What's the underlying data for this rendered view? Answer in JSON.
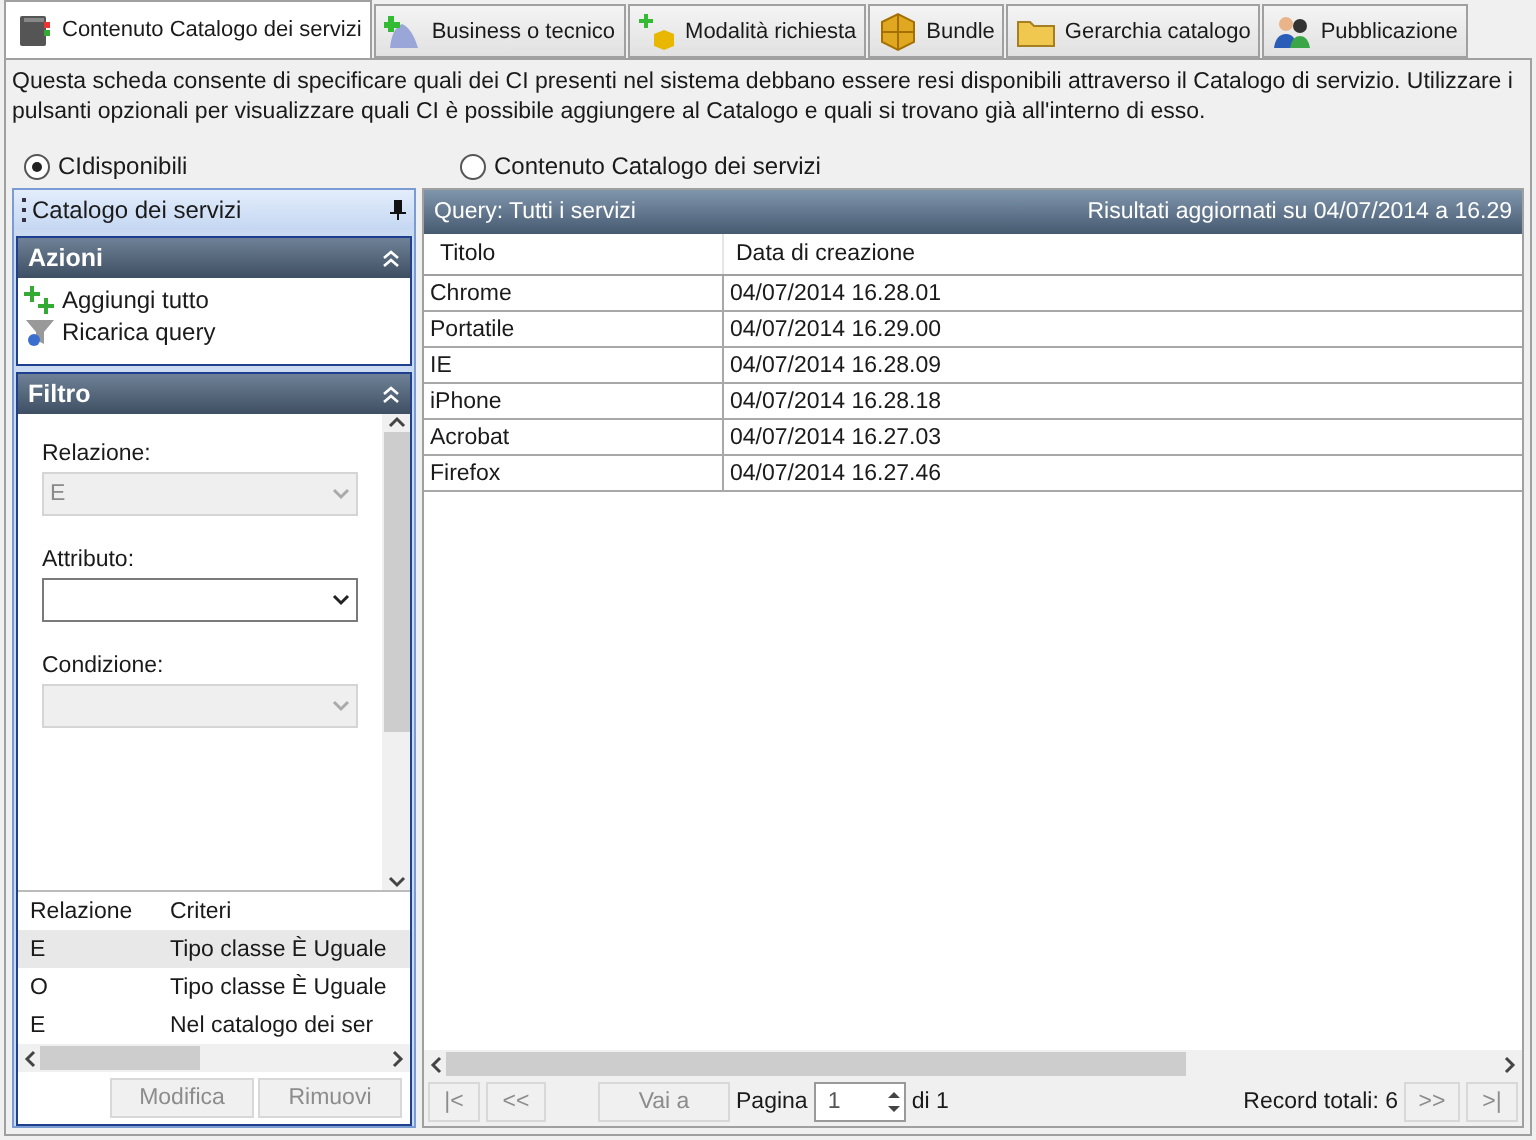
{
  "tabs": [
    {
      "label": "Contenuto Catalogo dei servizi",
      "selected": true
    },
    {
      "label": "Business o tecnico",
      "selected": false
    },
    {
      "label": "Modalità richiesta",
      "selected": false
    },
    {
      "label": "Bundle",
      "selected": false
    },
    {
      "label": "Gerarchia catalogo",
      "selected": false
    },
    {
      "label": "Pubblicazione",
      "selected": false
    }
  ],
  "description": "Questa scheda consente di specificare quali dei CI presenti nel sistema debbano essere resi disponibili attraverso il Catalogo di servizio. Utilizzare i pulsanti opzionali per visualizzare quali CI è possibile aggiungere al Catalogo e quali si trovano già all'interno di esso.",
  "radios": [
    {
      "label": "CIdisponibili",
      "selected": true
    },
    {
      "label": "Contenuto Catalogo dei servizi",
      "selected": false
    }
  ],
  "left_panel": {
    "title": "Catalogo dei servizi",
    "actions": {
      "title": "Azioni",
      "items": [
        {
          "label": "Aggiungi tutto"
        },
        {
          "label": "Ricarica query"
        }
      ]
    },
    "filter": {
      "title": "Filtro",
      "fields": [
        {
          "label": "Relazione:",
          "value": "E",
          "disabled": true
        },
        {
          "label": "Attributo:",
          "disabled": false
        },
        {
          "label": "Condizione:",
          "disabled": true
        }
      ],
      "criteria": {
        "columns": [
          "Relazione",
          "Criteri"
        ],
        "rows": [
          {
            "cells": [
              "E",
              "Tipo classe È Uguale"
            ],
            "selected": true
          },
          {
            "cells": [
              "O",
              "Tipo classe È Uguale"
            ],
            "selected": false
          },
          {
            "cells": [
              "E",
              "Nel catalogo dei ser"
            ],
            "selected": false
          }
        ]
      },
      "buttons": [
        {
          "label": "Modifica",
          "disabled": true
        },
        {
          "label": "Rimuovi",
          "disabled": true
        }
      ]
    }
  },
  "results": {
    "query": "Query: Tutti i servizi",
    "updated": "Risultati aggiornati su 04/07/2014 a 16.29",
    "columns": [
      "Titolo",
      "Data di creazione"
    ],
    "rows": [
      [
        "Chrome",
        "04/07/2014 16.28.01"
      ],
      [
        "Portatile",
        "04/07/2014 16.29.00"
      ],
      [
        "IE",
        "04/07/2014 16.28.09"
      ],
      [
        "iPhone",
        "04/07/2014 16.28.18"
      ],
      [
        "Acrobat",
        "04/07/2014 16.27.03"
      ],
      [
        "Firefox",
        "04/07/2014 16.27.46"
      ]
    ]
  },
  "pager": {
    "first": {
      "label": "|<",
      "disabled": true
    },
    "prev": {
      "label": "<<",
      "disabled": true
    },
    "goto": {
      "label": "Vai a",
      "disabled": true
    },
    "page_label": "Pagina",
    "page": "1",
    "of": "di 1",
    "total": "Record totali: 6",
    "next": {
      "label": ">>",
      "disabled": true
    },
    "last": {
      "label": ">|",
      "disabled": true
    }
  }
}
